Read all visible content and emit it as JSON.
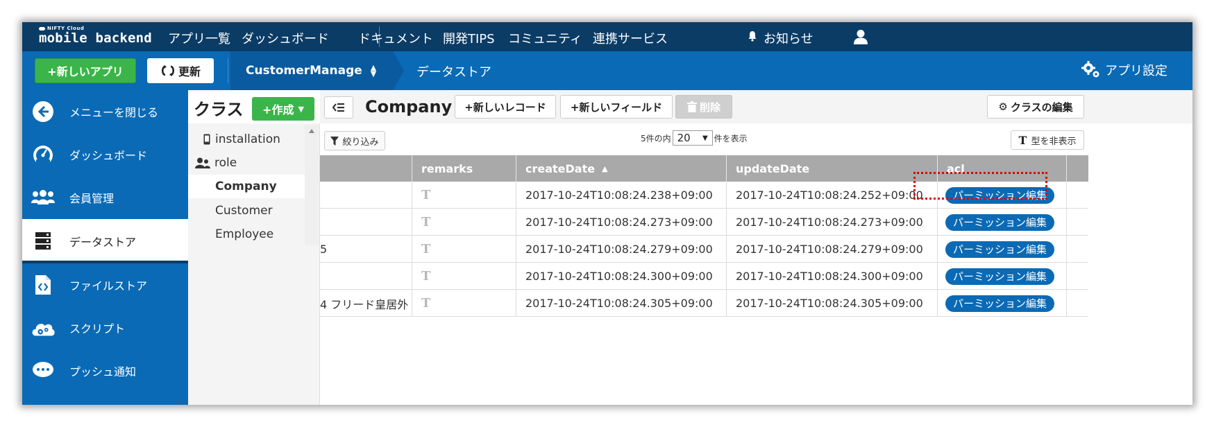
{
  "topnav": {
    "logo_small": "NIFTY Cloud",
    "logo_big": "mobile backend",
    "links": [
      "アプリ一覧",
      "ダッシュボード",
      "ドキュメント",
      "開発TIPS",
      "コミュニティ",
      "連携サービス"
    ],
    "notifications": "お知らせ",
    "icons": [
      "bell-icon",
      "user-icon"
    ]
  },
  "subbar": {
    "new_app": "+新しいアプリ",
    "refresh": "更新",
    "app_name": "CustomerManage",
    "breadcrumb": "データストア",
    "app_settings": "アプリ設定"
  },
  "sidebar": {
    "items": [
      {
        "label": "メニューを閉じる",
        "icon": "back-arrow-icon"
      },
      {
        "label": "ダッシュボード",
        "icon": "gauge-icon"
      },
      {
        "label": "会員管理",
        "icon": "users-icon"
      },
      {
        "label": "データストア",
        "icon": "database-icon",
        "active": true
      },
      {
        "label": "ファイルストア",
        "icon": "file-code-icon"
      },
      {
        "label": "スクリプト",
        "icon": "cloud-gear-icon"
      },
      {
        "label": "プッシュ通知",
        "icon": "chat-icon"
      }
    ]
  },
  "classes": {
    "title": "クラス",
    "create": "+作成",
    "items": [
      {
        "label": "installation",
        "icon": "phone-icon"
      },
      {
        "label": "role",
        "icon": "group-icon"
      },
      {
        "label": "Company",
        "selected": true
      },
      {
        "label": "Customer"
      },
      {
        "label": "Employee"
      }
    ]
  },
  "toolbar": {
    "class_name": "Company",
    "new_record": "+新しいレコード",
    "new_field": "+新しいフィールド",
    "delete": "削除",
    "edit_class": "クラスの編集"
  },
  "filterbar": {
    "filter": "絞り込み",
    "pager_prefix": "5件の内",
    "page_size": "20",
    "pager_suffix": "件を表示",
    "hide_types": "型を非表示"
  },
  "table": {
    "columns": [
      "",
      "remarks",
      "createDate",
      "updateDate",
      "acl"
    ],
    "sort_column": "createDate",
    "sort_direction": "asc",
    "rows": [
      {
        "partial": "",
        "remarks": "T",
        "createDate": "2017-10-24T10:08:24.238+09:00",
        "updateDate": "2017-10-24T10:08:24.252+09:00",
        "acl": "パーミッション編集"
      },
      {
        "partial": "",
        "remarks": "T",
        "createDate": "2017-10-24T10:08:24.273+09:00",
        "updateDate": "2017-10-24T10:08:24.273+09:00",
        "acl": "パーミッション編集"
      },
      {
        "partial": "5",
        "remarks": "T",
        "createDate": "2017-10-24T10:08:24.279+09:00",
        "updateDate": "2017-10-24T10:08:24.279+09:00",
        "acl": "パーミッション編集"
      },
      {
        "partial": "",
        "remarks": "T",
        "createDate": "2017-10-24T10:08:24.300+09:00",
        "updateDate": "2017-10-24T10:08:24.300+09:00",
        "acl": "パーミッション編集"
      },
      {
        "partial": "4 フリード皇居外",
        "remarks": "T",
        "createDate": "2017-10-24T10:08:24.305+09:00",
        "updateDate": "2017-10-24T10:08:24.305+09:00",
        "acl": "パーミッション編集"
      }
    ]
  },
  "colors": {
    "topnav": "#0b3c66",
    "subbar": "#0a6ab5",
    "green": "#3bb54a",
    "table_header": "#a9a9a9",
    "highlight": "#e00000"
  }
}
